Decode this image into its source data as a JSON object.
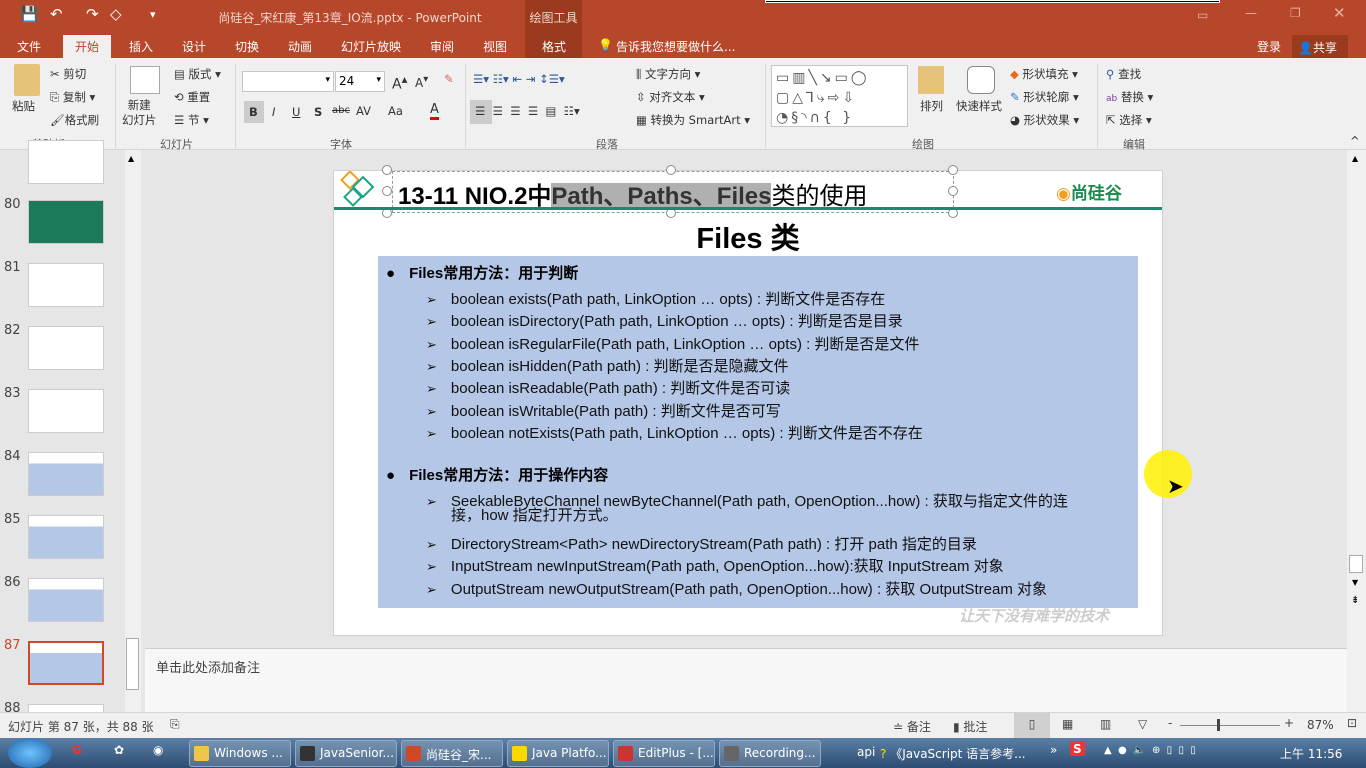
{
  "app": {
    "title": "尚硅谷_宋红康_第13章_IO流.pptx - PowerPoint",
    "context_tab_group": "绘图工具",
    "login": "登录",
    "share": "共享"
  },
  "tabs": [
    "文件",
    "开始",
    "插入",
    "设计",
    "切换",
    "动画",
    "幻灯片放映",
    "审阅",
    "视图",
    "格式"
  ],
  "active_tab": "开始",
  "tell_me": "告诉我您想要做什么...",
  "ribbon": {
    "clipboard": {
      "paste": "粘贴",
      "cut": "剪切",
      "copy": "复制",
      "format_painter": "格式刷",
      "label": "剪贴板"
    },
    "slides": {
      "new_slide": "新建\n幻灯片",
      "layout": "版式",
      "reset": "重置",
      "section": "节",
      "label": "幻灯片"
    },
    "font": {
      "font_name": "",
      "font_size": "24",
      "label": "字体",
      "bold": "B",
      "italic": "I",
      "underline": "U",
      "shadow": "S",
      "strike": "abc",
      "spacing": "AV",
      "case": "Aa",
      "color": "A"
    },
    "paragraph": {
      "text_direction": "文字方向",
      "align_text": "对齐文本",
      "smartart": "转换为 SmartArt",
      "label": "段落"
    },
    "drawing": {
      "arrange": "排列",
      "quick_styles": "快速样式",
      "fill": "形状填充",
      "outline": "形状轮廓",
      "effects": "形状效果",
      "label": "绘图"
    },
    "editing": {
      "find": "查找",
      "replace": "替换",
      "select": "选择",
      "label": "编辑"
    }
  },
  "thumbnails": [
    {
      "n": "80"
    },
    {
      "n": "81"
    },
    {
      "n": "82"
    },
    {
      "n": "83"
    },
    {
      "n": "84"
    },
    {
      "n": "85"
    },
    {
      "n": "86"
    },
    {
      "n": "87",
      "selected": true
    },
    {
      "n": "88"
    }
  ],
  "slide": {
    "title_a": "13-11 NIO.2中",
    "title_sel": "Path、Paths、Files",
    "title_b": "类的使用",
    "logo": "尚硅谷",
    "subtitle": "Files 类",
    "sections": [
      {
        "heading": "Files常用方法：用于判断",
        "items": [
          "boolean exists(Path path, LinkOption … opts) : 判断文件是否存在",
          "boolean isDirectory(Path path, LinkOption … opts) : 判断是否是目录",
          "boolean isRegularFile(Path path, LinkOption … opts) : 判断是否是文件",
          "boolean isHidden(Path path) : 判断是否是隐藏文件",
          "boolean isReadable(Path path) : 判断文件是否可读",
          "boolean isWritable(Path path) : 判断文件是否可写",
          "boolean notExists(Path path, LinkOption … opts) : 判断文件是否不存在"
        ]
      },
      {
        "heading": "Files常用方法：用于操作内容",
        "items": [
          "SeekableByteChannel newByteChannel(Path path, OpenOption...how) : 获取与指定文件的连",
          "接，how 指定打开方式。",
          "DirectoryStream<Path>  newDirectoryStream(Path path) : 打开 path 指定的目录",
          "InputStream newInputStream(Path path, OpenOption...how):获取 InputStream 对象",
          "OutputStream newOutputStream(Path path, OpenOption...how) : 获取 OutputStream 对象"
        ]
      }
    ],
    "watermark": "让天下没有难学的技术"
  },
  "notes_placeholder": "单击此处添加备注",
  "status": {
    "slide_info": "幻灯片 第 87 张，共 88 张",
    "notes": "备注",
    "comments": "批注",
    "zoom": "87%",
    "zoom_percent": 87
  },
  "taskbar": {
    "items": [
      "Windows ...",
      "JavaSenior...",
      "尚硅谷_宋...",
      "Java Platfo...",
      "EditPlus - [...",
      "Recording..."
    ],
    "extra": "api",
    "extra2": "《JavaScript 语言参考...",
    "clock": "上午 11:56"
  },
  "colors": {
    "accent": "#b7472a",
    "content_box": "#b4c7e7",
    "title_rule": "#1a8a6e"
  }
}
